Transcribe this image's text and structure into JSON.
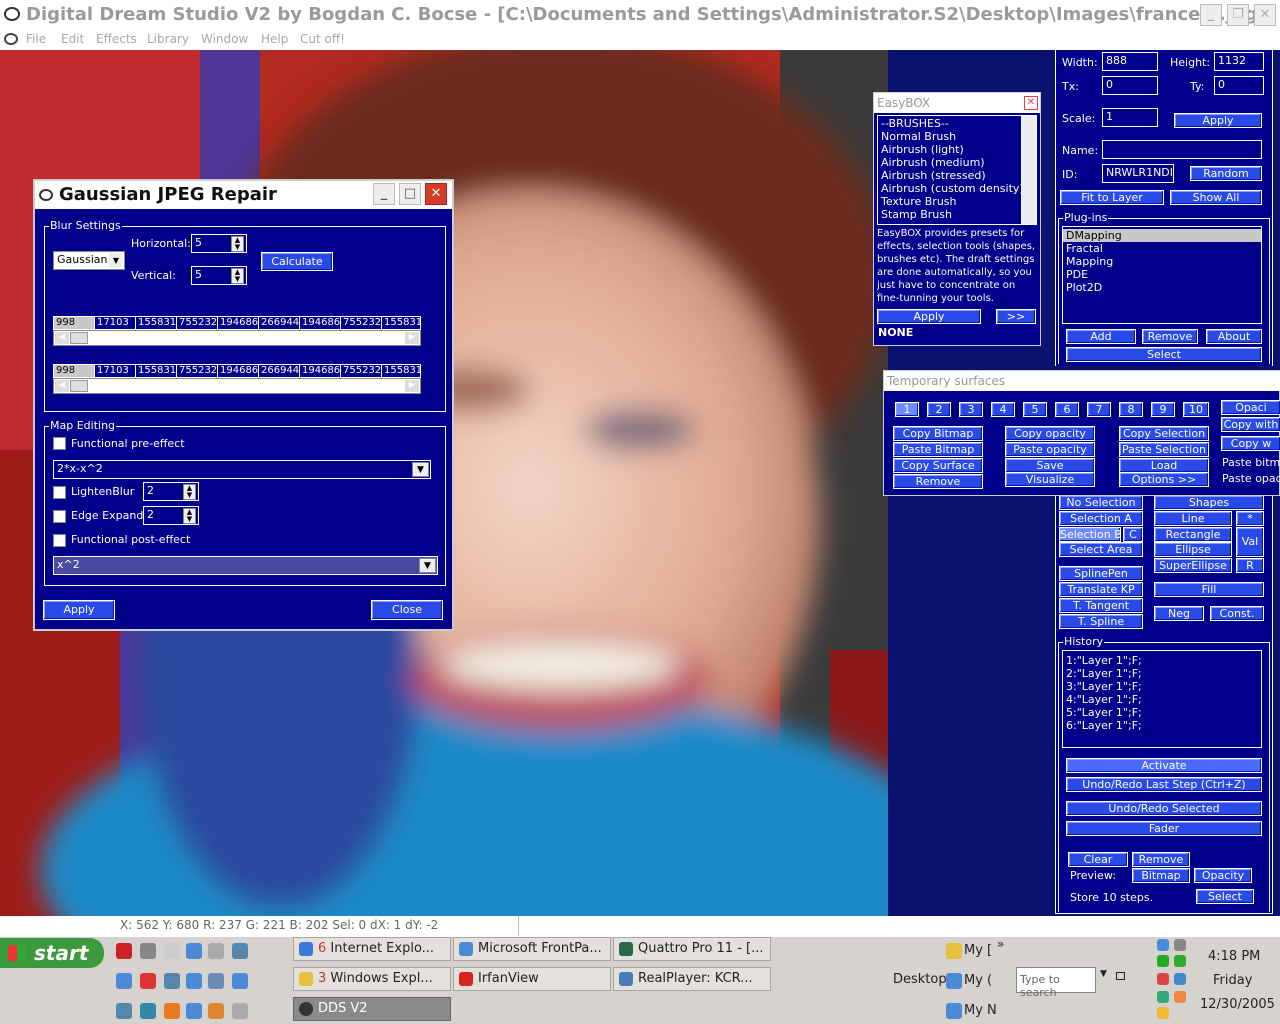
{
  "window": {
    "title": "Digital Dream Studio V2 by Bogdan C. Bocse - [C:\\Documents and Settings\\Administrator.S2\\Desktop\\Images\\francelll.jpg]"
  },
  "menu": [
    "File",
    "Edit",
    "Effects",
    "Library",
    "Window",
    "Help",
    "Cut off!"
  ],
  "gaussian": {
    "title": "Gaussian JPEG Repair",
    "blur_group": "Blur Settings",
    "method": "Gaussian",
    "horizontal_label": "Horizontal:",
    "horizontal_value": "5",
    "vertical_label": "Vertical:",
    "vertical_value": "5",
    "calculate": "Calculate",
    "kernel_row1": [
      "998",
      "17103",
      "155831",
      "755232",
      "194686",
      "266944",
      "194686",
      "755232",
      "155831"
    ],
    "kernel_row2": [
      "998",
      "17103",
      "155831",
      "755232",
      "194686",
      "266944",
      "194686",
      "755232",
      "155831"
    ],
    "map_group": "Map Editing",
    "functional_pre": "Functional pre-effect",
    "pre_formula": "2*x-x^2",
    "lighten_blur": "LightenBlur",
    "lighten_value": "2",
    "edge_expand": "Edge Expand",
    "edge_value": "2",
    "functional_post": "Functional post-effect",
    "post_formula": "x^2",
    "apply": "Apply",
    "close": "Close"
  },
  "easybox": {
    "title": "EasyBOX",
    "items": [
      "--BRUSHES--",
      "Normal Brush",
      "Airbrush (light)",
      "Airbrush (medium)",
      "Airbrush (stressed)",
      "Airbrush (custom density)",
      "Texture Brush",
      "Stamp Brush"
    ],
    "description": "EasyBOX provides presets for effects, selection tools (shapes, brushes etc). The draft settings are done automatically, so you just have to concentrate on fine-tunning your tools.",
    "apply": "Apply",
    "more": ">>",
    "status": "NONE"
  },
  "layer": {
    "width_label": "Width:",
    "width_value": "888",
    "height_label": "Height:",
    "height_value": "1132",
    "tx_label": "Tx:",
    "tx_value": "0",
    "ty_label": "Ty:",
    "ty_value": "0",
    "scale_label": "Scale:",
    "scale_value": "1",
    "apply": "Apply",
    "name_label": "Name:",
    "name_value": "",
    "id_label": "ID:",
    "id_value": "NRWLR1NDI",
    "random": "Random",
    "fit": "Fit to Layer",
    "show_all": "Show All"
  },
  "plugins": {
    "title": "Plug-ins",
    "items": [
      "DMapping",
      "Fractal",
      "Mapping",
      "PDE",
      "Plot2D"
    ],
    "add": "Add",
    "remove": "Remove",
    "about": "About",
    "select": "Select"
  },
  "temp": {
    "title": "Temporary surfaces",
    "slots": [
      "1",
      "2",
      "3",
      "4",
      "5",
      "6",
      "7",
      "8",
      "9",
      "10"
    ],
    "opacity": "Opaci",
    "copy_bitmap": "Copy Bitmap",
    "paste_bitmap": "Paste Bitmap",
    "copy_surface": "Copy Surface",
    "remove": "Remove",
    "copy_opacity": "Copy opacity",
    "paste_opacity": "Paste opacity",
    "save": "Save",
    "visualize": "Visualize",
    "copy_selection": "Copy Selection",
    "paste_selection": "Paste Selection",
    "load": "Load",
    "options": "Options >>",
    "copy_with": "Copy with",
    "copy_w": "Copy w",
    "paste_bitmap_txt": "Paste bitmap",
    "paste_opacity_txt": "Paste opaci"
  },
  "tools": {
    "no_selection": "No Selection",
    "selection_a": "Selection A",
    "selection_b": "Selection B",
    "c": "C",
    "select_area": "Select Area",
    "shapes": "Shapes",
    "line": "Line",
    "rectangle": "Rectangle",
    "ellipse": "Ellipse",
    "superellipse": "SuperEllipse",
    "star": "*",
    "val": "Val",
    "r": "R",
    "splinepen": "SplinePen",
    "translate_kp": "Translate KP",
    "t_tangent": "T. Tangent",
    "t_spline": "T. Spline",
    "fill": "Fill",
    "neg": "Neg",
    "const": "Const."
  },
  "history": {
    "title": "History",
    "items": [
      "1:\"Layer 1\";F;",
      "2:\"Layer 1\";F;",
      "3:\"Layer 1\";F;",
      "4:\"Layer 1\";F;",
      "5:\"Layer 1\";F;",
      "6:\"Layer 1\";F;"
    ],
    "activate": "Activate",
    "undo_last": "Undo/Redo Last Step (Ctrl+Z)",
    "undo_selected": "Undo/Redo Selected",
    "fader": "Fader",
    "clear": "Clear",
    "remove": "Remove",
    "preview_label": "Preview:",
    "bitmap": "Bitmap",
    "opacity": "Opacity",
    "store_label": "Store 10 steps.",
    "select": "Select"
  },
  "status": "X: 562 Y: 680 R: 237 G: 221 B: 202 Sel: 0 dX: 1 dY: -2",
  "taskbar": {
    "start": "start",
    "row1": [
      {
        "count": "6",
        "label": "Internet Explo..."
      },
      {
        "count": "",
        "label": "Microsoft FrontPa..."
      },
      {
        "count": "",
        "label": "Quattro Pro 11 - [..."
      }
    ],
    "row2": [
      {
        "count": "3",
        "label": "Windows Expl..."
      },
      {
        "count": "",
        "label": "IrfanView"
      },
      {
        "count": "",
        "label": "RealPlayer:  KCR..."
      }
    ],
    "row3": [
      {
        "count": "",
        "label": "DDS V2"
      }
    ],
    "desktop": "Desktop",
    "my1": "My [",
    "my2": "My (",
    "my3": "My N",
    "search_placeholder": "Type to search",
    "time": "4:18 PM",
    "day": "Friday",
    "date": "12/30/2005"
  }
}
